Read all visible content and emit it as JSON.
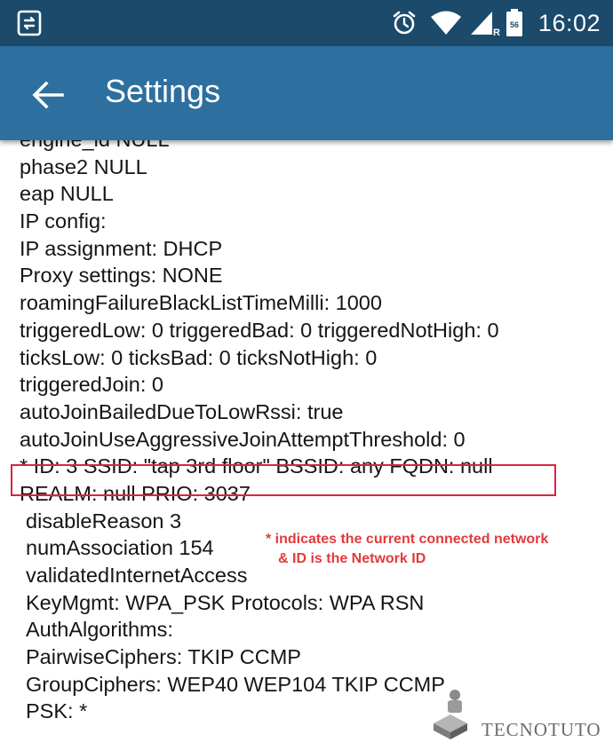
{
  "status_bar": {
    "time": "16:02",
    "left_icon": "screen-cast-icon",
    "icons": [
      "alarm-icon",
      "wifi-icon",
      "cell-signal-icon",
      "battery-icon"
    ],
    "roaming_label": "R",
    "battery_label": "56"
  },
  "app_bar": {
    "title": "Settings",
    "back_icon": "arrow-back-icon"
  },
  "content": {
    "lines": [
      "engine_id NULL",
      "phase2 NULL",
      "eap NULL",
      "IP config:",
      "IP assignment: DHCP",
      "Proxy settings: NONE",
      "roamingFailureBlackListTimeMilli: 1000",
      "triggeredLow: 0 triggeredBad: 0 triggeredNotHigh: 0",
      "ticksLow: 0 ticksBad: 0 ticksNotHigh: 0",
      "triggeredJoin: 0",
      "autoJoinBailedDueToLowRssi: true",
      "autoJoinUseAggressiveJoinAttemptThreshold: 0",
      "* ID: 3 SSID: \"tap 3rd floor\" BSSID: any FQDN: null",
      "REALM: null PRIO: 3037",
      "disableReason 3",
      "numAssociation 154",
      "validatedInternetAccess",
      "KeyMgmt: WPA_PSK Protocols: WPA RSN",
      "AuthAlgorithms:",
      "PairwiseCiphers: TKIP CCMP",
      "GroupCiphers: WEP40 WEP104 TKIP CCMP",
      "PSK: *"
    ]
  },
  "annotation": {
    "line1": "* indicates the current connected network",
    "line2": "& ID is the Network ID",
    "color": "#e33a3a",
    "box_color": "#d7263d"
  },
  "watermark": {
    "text": "TECNOTUTO",
    "icon": "robot-logo-icon"
  },
  "colors": {
    "status_bar": "#1b4a6b",
    "app_bar": "#2d6f9e",
    "text": "#151515"
  }
}
